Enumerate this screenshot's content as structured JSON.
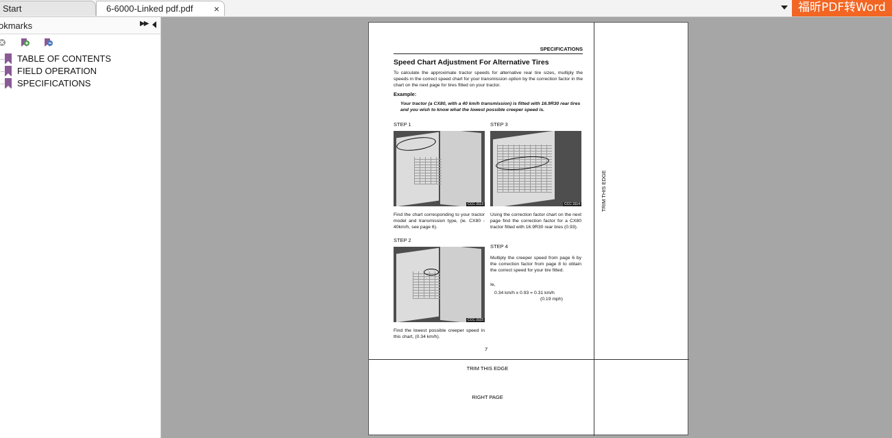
{
  "tabs": {
    "start_label": "Start",
    "doc_label": "6-6000-Linked pdf.pdf",
    "close_glyph": "×"
  },
  "brand": {
    "label": "福昕PDF转Word",
    "color": "#f26522"
  },
  "sidebar": {
    "title": "okmarks",
    "expand_glyph": "▶▶",
    "tools": [
      "delete-bookmark-icon",
      "add-bookmark-icon",
      "find-bookmark-icon"
    ],
    "bookmarks": [
      {
        "label": "TABLE OF CONTENTS"
      },
      {
        "label": "FIELD OPERATION"
      },
      {
        "label": "SPECIFICATIONS"
      }
    ]
  },
  "document": {
    "section_header": "SPECIFICATIONS",
    "title": "Speed Chart Adjustment For Alternative Tires",
    "intro": "To calculate the approximate tractor speeds for alternative rear tire sizes, multiply the speeds in the correct speed chart for your transmission option by the correction factor in the chart on the next page for tires fitted on your tractor.",
    "example_label": "Example:",
    "example_text": "Your tractor (a CX80, with a 40 km/h transmission) is fitted with 16.9R30 rear tires and you wish to know what the lowest possible creeper speed is.",
    "step1": {
      "label": "STEP  1",
      "tag": "CCC 3113",
      "text": "Find the chart corresponding to your tractor model and transmission type, (ie. CX80 - 40km/h, see page 6)."
    },
    "step2": {
      "label": "STEP  2",
      "tag": "CCC 3115",
      "text": "Find the lowest possible creeper speed in this chart, (0.34 km/h)."
    },
    "step3": {
      "label": "STEP  3",
      "tag": "CCC 3114",
      "text": "Using the correction factor chart on the next page find the correction factor for a CX80 tractor fitted with 16.9R30 rear tires (0.93)."
    },
    "step4": {
      "label": "STEP  4",
      "text": "Multiply the creeper speed from page 6 by the correction factor from page 8 to obtain the correct speed for your tire fitted.",
      "ie": "Ie,",
      "calc1": "0.34 km/h x 0.93 = 0.31 km/h",
      "calc2": "(0.19 mph)"
    },
    "page_number": "7",
    "trim_bottom": "TRIM THIS EDGE",
    "right_page": "RIGHT PAGE",
    "trim_side": "TRIM THIS EDGE"
  }
}
